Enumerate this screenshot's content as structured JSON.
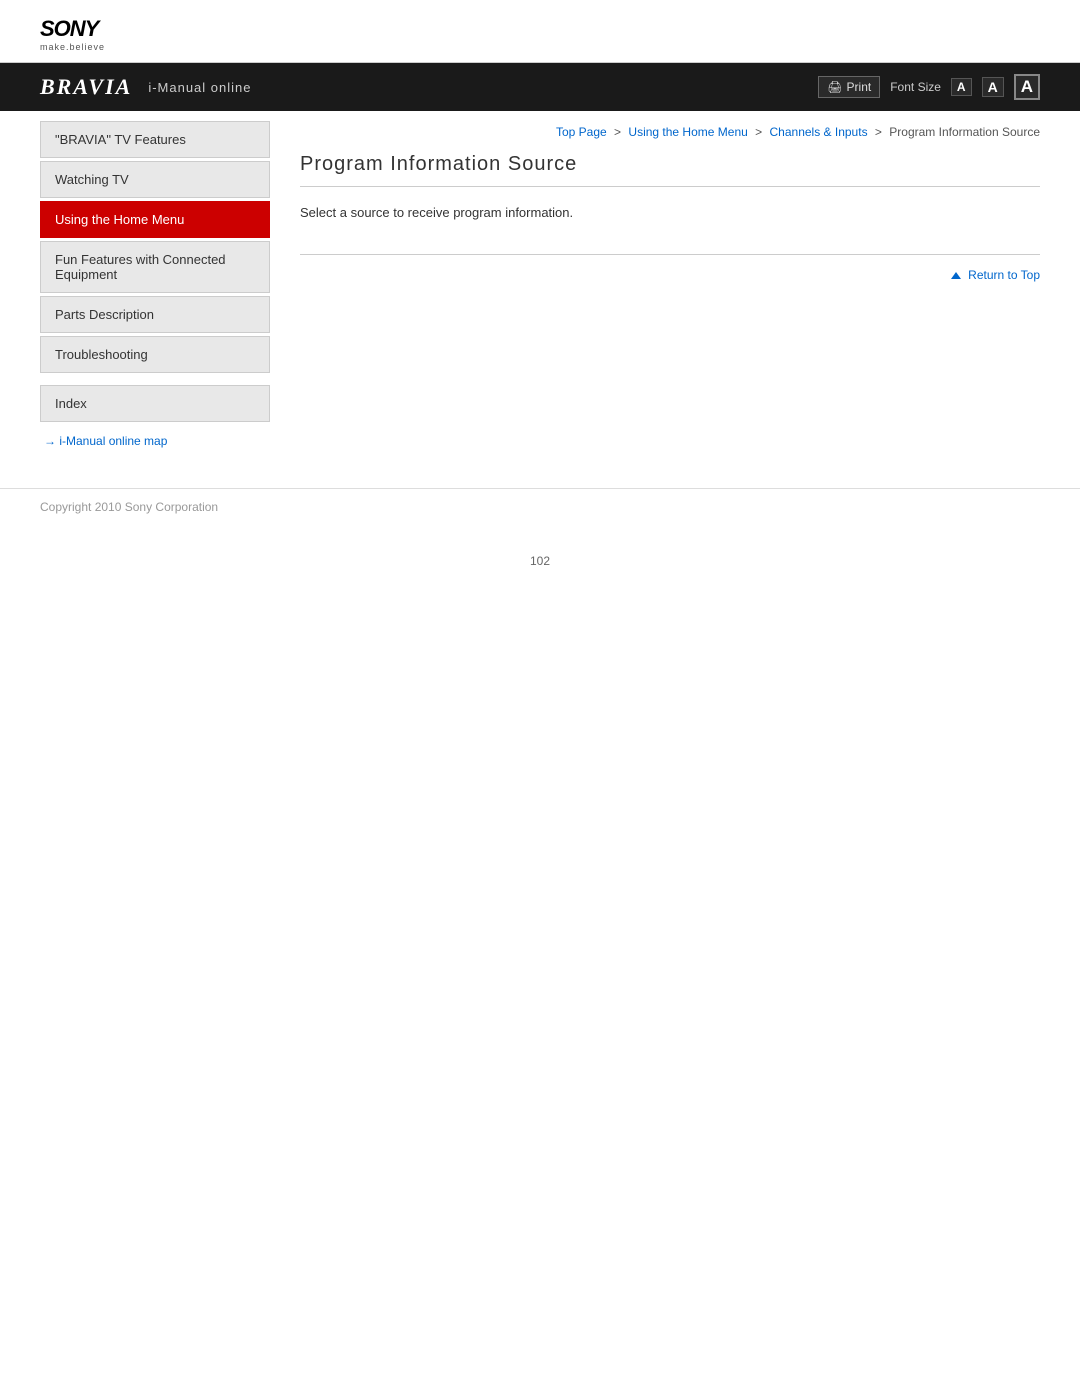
{
  "header": {
    "sony_logo": "SONY",
    "sony_tagline": "make.believe",
    "bravia_logo": "BRAVIA",
    "bravia_subtitle": "i-Manual online",
    "print_label": "Print",
    "font_size_label": "Font Size",
    "font_size_small": "A",
    "font_size_medium": "A",
    "font_size_large": "A"
  },
  "breadcrumb": {
    "top_page": "Top Page",
    "using_home_menu": "Using the Home Menu",
    "channels_inputs": "Channels & Inputs",
    "current": "Program Information Source"
  },
  "sidebar": {
    "items": [
      {
        "label": "\"BRAVIA\" TV Features",
        "active": false,
        "id": "bravia-features"
      },
      {
        "label": "Watching TV",
        "active": false,
        "id": "watching-tv"
      },
      {
        "label": "Using the Home Menu",
        "active": true,
        "id": "using-home-menu"
      },
      {
        "label": "Fun Features with Connected Equipment",
        "active": false,
        "id": "fun-features"
      },
      {
        "label": "Parts Description",
        "active": false,
        "id": "parts-description"
      },
      {
        "label": "Troubleshooting",
        "active": false,
        "id": "troubleshooting"
      }
    ],
    "index_label": "Index",
    "imanual_link": "→ i-Manual online map"
  },
  "content": {
    "page_title": "Program Information Source",
    "description": "Select a source to receive program information."
  },
  "return_top": {
    "label": "Return to Top"
  },
  "footer": {
    "copyright": "Copyright 2010 Sony Corporation"
  },
  "page_number": "102"
}
